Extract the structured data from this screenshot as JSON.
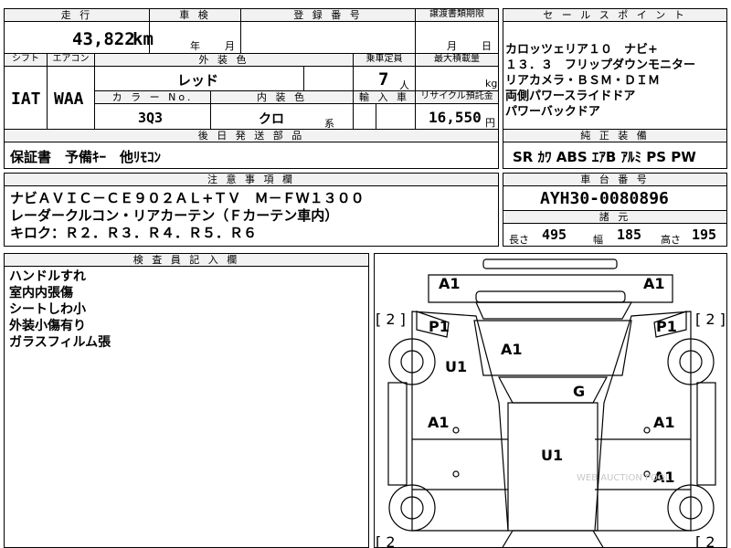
{
  "top_row": {
    "mileage_label": "走 行",
    "mileage_value": "43,822",
    "mileage_unit": "km",
    "inspection_label": "車 検",
    "year_unit": "年",
    "month_unit": "月",
    "registration_label": "登 録 番 号",
    "transfer_label": "譲渡書類期限",
    "transfer_month_unit": "月",
    "transfer_day_unit": "日"
  },
  "spec_row": {
    "shift_label": "シフト",
    "shift_value": "IAT",
    "aircon_label": "エアコン",
    "aircon_value": "WAA",
    "exterior_color_label": "外 装 色",
    "exterior_color_value": "レッド",
    "capacity_label": "乗車定員",
    "capacity_value": "7",
    "capacity_unit": "人",
    "max_load_label": "最大積載量",
    "max_load_unit": "kg",
    "color_no_label": "カ ラ ー No.",
    "color_no_value": "3Q3",
    "interior_color_label": "内 装 色",
    "interior_color_value": "クロ",
    "interior_color_suffix": "系",
    "import_label": "輸 入 車",
    "recycle_label": "リサイクル預託金",
    "recycle_value": "16,550",
    "recycle_unit": "円"
  },
  "later_parts": {
    "label": "後 日 発 送 部 品",
    "value": "保証書　予備ｷｰ　他ﾘﾓｺﾝ"
  },
  "notes": {
    "label": "注 意 事 項 欄",
    "lines": [
      "ナビＡＶＩＣ－ＣＥ９０２ＡＬ+ＴＶ　Ｍ－ＦＷ１３００",
      "レーダークルコン・リアカーテン（Ｆカーテン車内）",
      "キロク：Ｒ２．Ｒ３．Ｒ４．Ｒ５．Ｒ６"
    ]
  },
  "inspector": {
    "label": "検 査 員 記 入 欄",
    "lines": [
      "ハンドルすれ",
      "室内内張傷",
      "シートしわ小",
      "外装小傷有り",
      "ガラスフィルム張"
    ]
  },
  "sales_points": {
    "label": "セ ー ル ス ポ イ ン ト",
    "lines": [
      "カロッツェリア１０　ナビ+",
      "１３．３　フリップダウンモニター",
      "リアカメラ・ＢＳＭ・ＤＩＭ",
      "両側パワースライドドア",
      "パワーバックドア"
    ]
  },
  "equipment": {
    "label": "純 正 装 備",
    "value": "SR ｶﾜ ABS ｴｱB ｱﾙﾐ PS PW"
  },
  "chassis": {
    "label": "車 台 番 号",
    "value": "AYH30-0080896"
  },
  "dimensions": {
    "label": "諸 元",
    "length_label": "長さ",
    "length_value": "495",
    "width_label": "幅",
    "width_value": "185",
    "height_label": "高さ",
    "height_value": "195"
  },
  "diagram": {
    "marks": {
      "front_left": "A1",
      "front_right": "A1",
      "pillar_left": "P1",
      "pillar_right": "P1",
      "bracket_top_left": "[ 2 ]",
      "bracket_top_right": "[ 2 ]",
      "bracket_bottom_left": "[ 2",
      "bracket_bottom_right": "[ 2",
      "hood": "A1",
      "fender_left": "U1",
      "windshield": "G",
      "door_left": "A1",
      "door_right": "A1",
      "roof": "U1",
      "rear_right": "A1"
    },
    "watermark": "WEB AUCTION POOL"
  }
}
